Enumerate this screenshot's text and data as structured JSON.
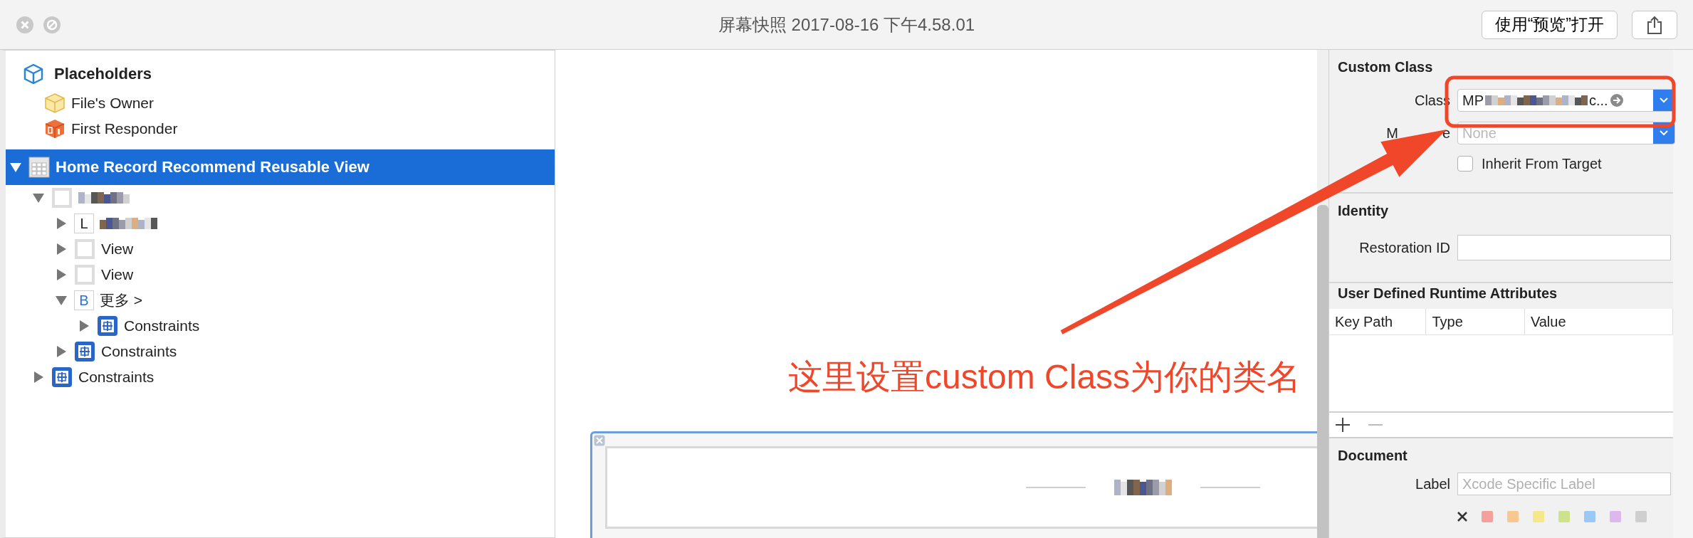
{
  "window": {
    "title": "屏幕快照 2017-08-16 下午4.58.01",
    "open_button": "使用“预览”打开"
  },
  "outline": {
    "placeholders": {
      "title": "Placeholders",
      "items": [
        {
          "label": "File's Owner",
          "kind": "owner"
        },
        {
          "label": "First Responder",
          "kind": "responder"
        }
      ]
    },
    "tree": [
      {
        "label": "Home Record Recommend Reusable View",
        "kind": "reusable",
        "expanded": true,
        "selected": true,
        "children": [
          {
            "kind": "view",
            "redacted": true,
            "expanded": true,
            "selected": false,
            "children": [
              {
                "kind": "label",
                "badge": "L",
                "redacted": true,
                "expanded": false,
                "selected": false
              },
              {
                "label": "View",
                "kind": "view",
                "expanded": false,
                "selected": false
              },
              {
                "label": "View",
                "kind": "view",
                "expanded": false,
                "selected": false
              },
              {
                "label": "更多 >",
                "kind": "button",
                "badge": "B",
                "expanded": true,
                "selected": false,
                "children": [
                  {
                    "label": "Constraints",
                    "kind": "constraints",
                    "expanded": false,
                    "selected": false
                  }
                ]
              },
              {
                "label": "Constraints",
                "kind": "constraints",
                "expanded": false,
                "selected": false
              }
            ]
          },
          {
            "label": "Constraints",
            "kind": "constraints",
            "expanded": false,
            "selected": false
          }
        ]
      }
    ]
  },
  "inspector": {
    "custom_class": {
      "title": "Custom Class",
      "class_label": "Class",
      "class_value": "MP",
      "class_value_tail": "c...",
      "module_label_parts": [
        "M",
        "e"
      ],
      "module_placeholder": "None",
      "inherit": {
        "label": "Inherit From Target",
        "checked": false
      }
    },
    "identity": {
      "title": "Identity",
      "restoration_label": "Restoration ID"
    },
    "runtime_attributes": {
      "title": "User Defined Runtime Attributes",
      "columns": [
        "Key Path",
        "Type",
        "Value"
      ],
      "remove_disabled": true
    },
    "document": {
      "title": "Document",
      "label_label": "Label",
      "label_placeholder": "Xcode Specific Label",
      "colors": [
        {
          "color": "#f4a09c"
        },
        {
          "color": "#f8c890"
        },
        {
          "color": "#f6e88a"
        },
        {
          "color": "#cde28a"
        },
        {
          "color": "#9cc8f8"
        },
        {
          "color": "#ddb8ee"
        },
        {
          "color": "#cfcfcf"
        }
      ]
    }
  },
  "annotation": {
    "text": "这里设置custom Class为你的类名"
  }
}
